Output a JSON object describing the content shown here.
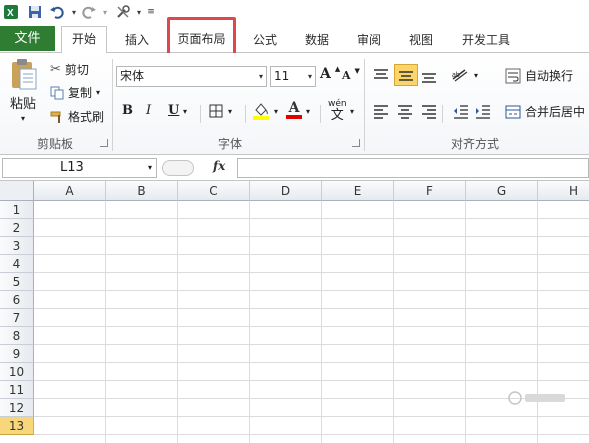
{
  "tabs": {
    "file": "文件",
    "home": "开始",
    "insert": "插入",
    "page_layout": "页面布局",
    "formulas": "公式",
    "data": "数据",
    "review": "审阅",
    "view": "视图",
    "developer": "开发工具"
  },
  "clipboard": {
    "paste": "粘贴",
    "cut": "剪切",
    "copy": "复制",
    "format_painter": "格式刷",
    "group_label": "剪贴板"
  },
  "font": {
    "name": "宋体",
    "size": "11",
    "bold": "B",
    "italic": "I",
    "underline": "U",
    "grow": "A",
    "shrink": "A",
    "font_color_glyph": "A",
    "phonetic": "wén",
    "phonetic_char": "文",
    "group_label": "字体"
  },
  "alignment": {
    "wrap_text": "自动换行",
    "merge_center": "合并后居中",
    "group_label": "对齐方式"
  },
  "formula_bar": {
    "name_box": "L13",
    "fx": "fx",
    "value": ""
  },
  "columns": [
    "A",
    "B",
    "C",
    "D",
    "E",
    "F",
    "G",
    "H"
  ],
  "rows": [
    "1",
    "2",
    "3",
    "4",
    "5",
    "6",
    "7",
    "8",
    "9",
    "10",
    "11",
    "12",
    "13"
  ],
  "selected_row": "13",
  "colors": {
    "file_tab": "#2e7d32",
    "highlight_box": "#e0474c",
    "selected_row": "#f7d77a"
  }
}
